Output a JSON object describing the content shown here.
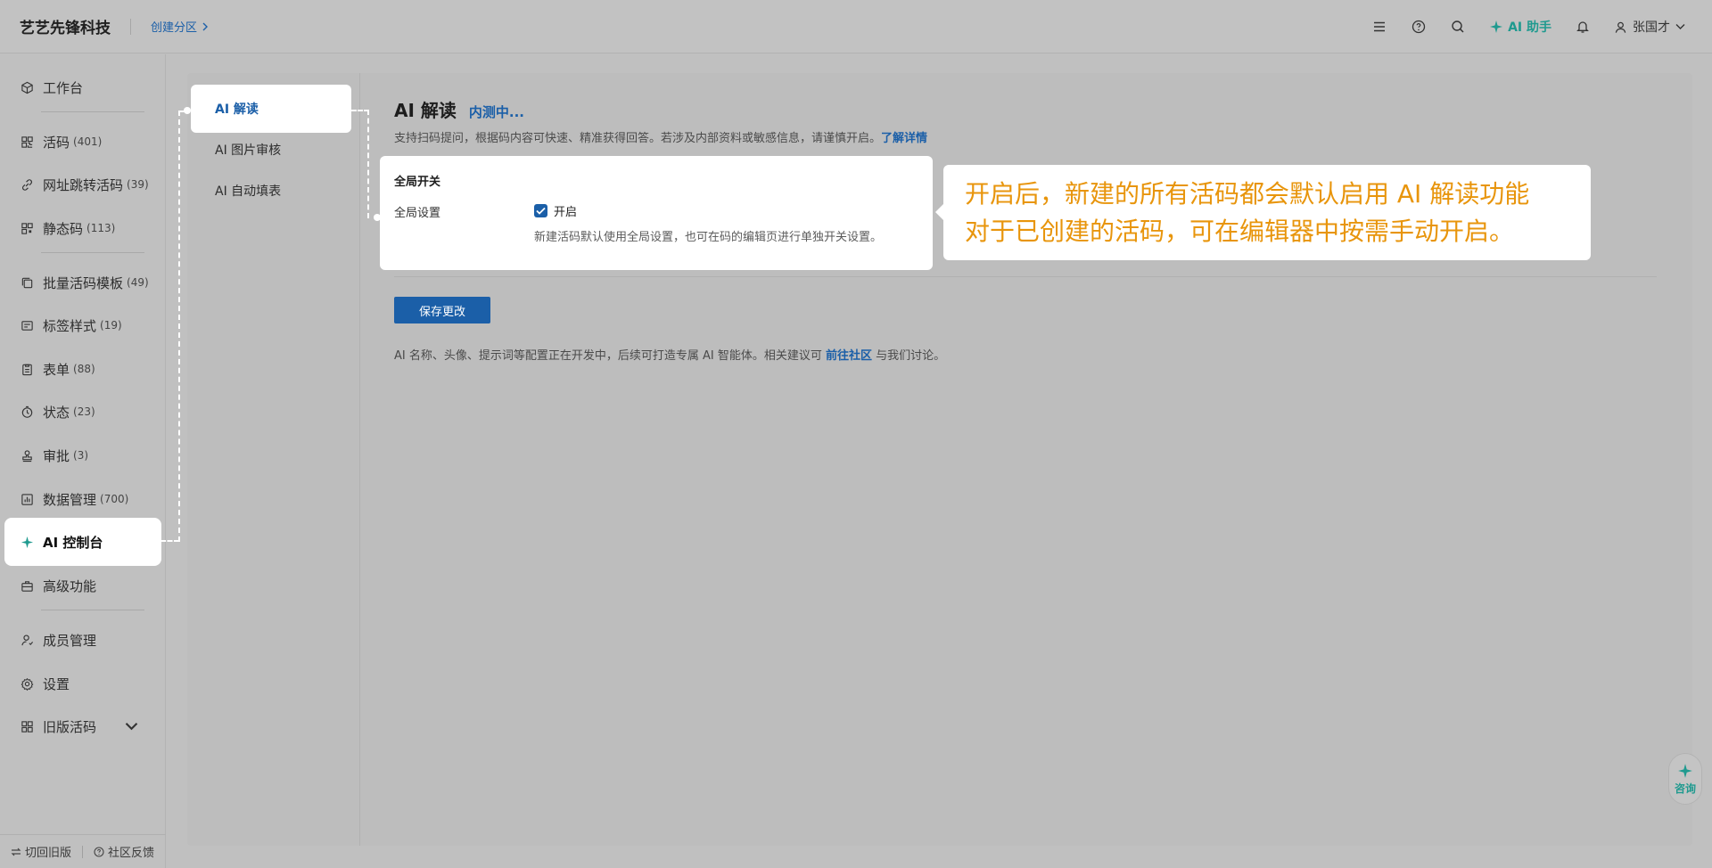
{
  "header": {
    "brand": "艺艺先锋科技",
    "breadcrumb": "创建分区",
    "ai_helper": "AI 助手",
    "user_name": "张国才"
  },
  "sidebar": {
    "items": [
      {
        "label": "工作台",
        "count": ""
      },
      {
        "label": "活码",
        "count": "(401)"
      },
      {
        "label": "网址跳转活码",
        "count": "(39)"
      },
      {
        "label": "静态码",
        "count": "(113)"
      },
      {
        "label": "批量活码模板",
        "count": "(49)"
      },
      {
        "label": "标签样式",
        "count": "(19)"
      },
      {
        "label": "表单",
        "count": "(88)"
      },
      {
        "label": "状态",
        "count": "(23)"
      },
      {
        "label": "审批",
        "count": "(3)"
      },
      {
        "label": "数据管理",
        "count": "(700)"
      },
      {
        "label": "AI 控制台",
        "count": ""
      },
      {
        "label": "高级功能",
        "count": ""
      },
      {
        "label": "成员管理",
        "count": ""
      },
      {
        "label": "设置",
        "count": ""
      },
      {
        "label": "旧版活码",
        "count": ""
      }
    ],
    "footer": {
      "switch_old": "切回旧版",
      "feedback": "社区反馈"
    }
  },
  "subnav": {
    "items": [
      "AI 解读",
      "AI 图片审核",
      "AI 自动填表"
    ]
  },
  "content": {
    "title": "AI 解读",
    "beta": "内测中...",
    "description": "支持扫码提问，根据码内容可快速、精准获得回答。若涉及内部资料或敏感信息，请谨慎开启。",
    "learn_more": "了解详情",
    "switch_card": {
      "title": "全局开关",
      "label": "全局设置",
      "checkbox_label": "开启",
      "hint": "新建活码默认使用全局设置，也可在码的编辑页进行单独开关设置。"
    },
    "save_button": "保存更改",
    "note_prefix": "AI 名称、头像、提示词等配置正在开发中，后续可打造专属 AI 智能体。相关建议可",
    "note_link": "前往社区",
    "note_suffix": "与我们讨论。"
  },
  "callout": {
    "line1": "开启后，新建的所有活码都会默认启用 AI 解读功能",
    "line2": "对于已创建的活码，可在编辑器中按需手动开启。"
  },
  "consult": "咨询",
  "colors": {
    "accent_blue": "#1b5fa8",
    "ai_teal": "#1f9a8f",
    "callout_orange": "#e8950c"
  }
}
